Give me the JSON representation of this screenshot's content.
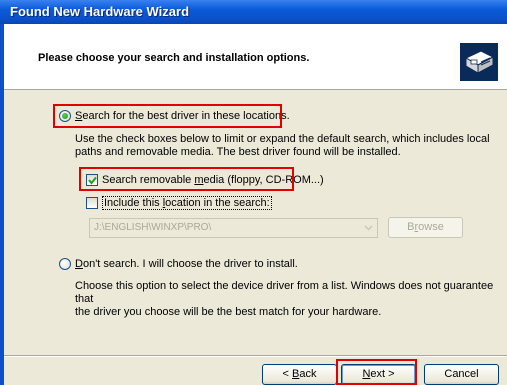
{
  "window": {
    "title": "Found New Hardware Wizard"
  },
  "header": {
    "title": "Please choose your search and installation options.",
    "icon": "hardware-install-icon"
  },
  "options": {
    "search_best": {
      "label_pre": "",
      "label_accel": "S",
      "label_post": "earch for the best driver in these locations.",
      "checked": true
    },
    "search_desc_1": "Use the check boxes below to limit or expand the default search, which includes local",
    "search_desc_2": "paths and removable media. The best driver found will be installed.",
    "removable_media": {
      "label_pre": "Search removable ",
      "label_accel": "m",
      "label_post": "edia (floppy, CD-ROM...)",
      "checked": true
    },
    "include_location": {
      "label_pre": "Include this ",
      "label_accel": "l",
      "label_post": "ocation in the search:",
      "checked": false
    },
    "path_value": "J:\\ENGLISH\\WINXP\\PRO\\",
    "browse_pre": "B",
    "browse_accel": "r",
    "browse_post": "owse",
    "dont_search": {
      "label_pre": "",
      "label_accel": "D",
      "label_post": "on't search. I will choose the driver to install.",
      "checked": false
    },
    "dont_desc_1": "Choose this option to select the device driver from a list.  Windows does not guarantee that",
    "dont_desc_2": "the driver you choose will be the best match for your hardware."
  },
  "buttons": {
    "back_pre": "< ",
    "back_accel": "B",
    "back_post": "ack",
    "next_accel": "N",
    "next_post": "ext >",
    "cancel": "Cancel"
  },
  "colors": {
    "highlight": "#e00000",
    "titlebar": "#0a5ad8"
  }
}
